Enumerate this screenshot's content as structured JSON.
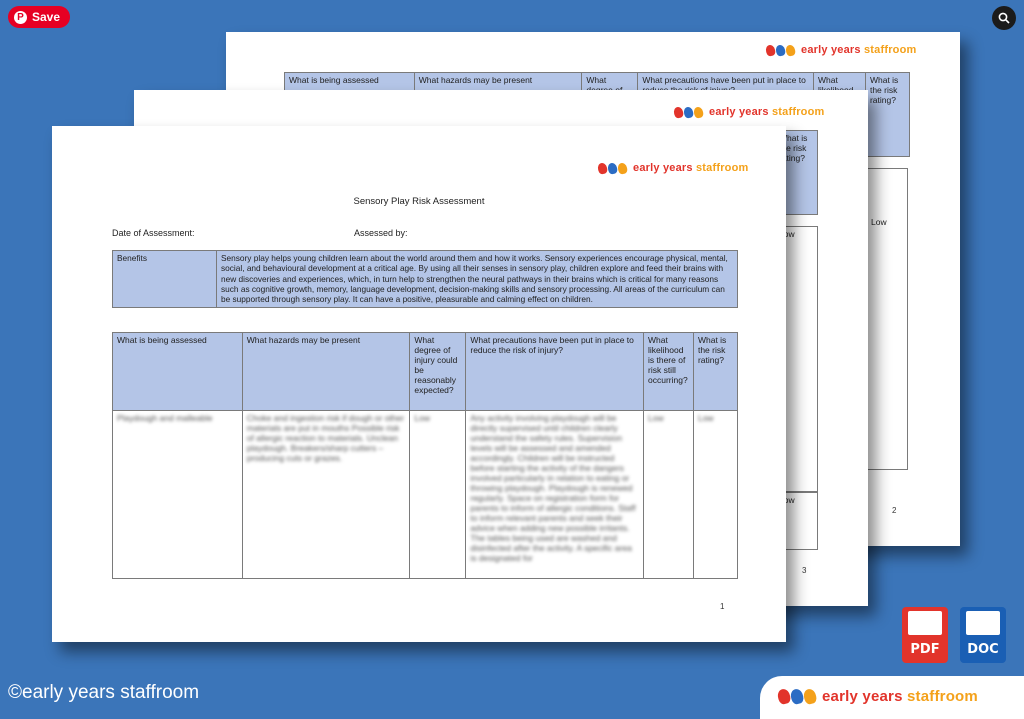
{
  "toolbar": {
    "save_label": "Save",
    "lens_icon": "visual-search-icon"
  },
  "brand": {
    "early": "early years",
    "staffroom": "staffroom",
    "copyright": "©early years staffroom"
  },
  "colors": {
    "background": "#3b75b9",
    "header_fill": "#b4c5e7",
    "save_red": "#e60023",
    "pdf_red": "#e2342b",
    "doc_blue": "#1a5fb4"
  },
  "page2": {
    "headers": [
      "What is being assessed",
      "What hazards may be present",
      "What degree of",
      "What precautions have been put in place to reduce the risk of injury?",
      "What likelihood",
      "What is the risk rating?"
    ],
    "low": "Low",
    "page_number": "2"
  },
  "page3": {
    "header_fragment": "What is the risk rating?",
    "low_1": "Low",
    "low_2": "Low",
    "page_number": "3"
  },
  "page1": {
    "title": "Sensory Play Risk Assessment",
    "date_label": "Date of Assessment:",
    "assessed_by_label": "Assessed by:",
    "benefits_label": "Benefits",
    "benefits_text": "Sensory play helps young children learn about the world around them and how it works. Sensory experiences encourage physical, mental, social, and behavioural development at a critical age. By using all their senses in sensory play, children explore and feed their brains with new discoveries and experiences, which, in turn help to strengthen the neural pathways in their brains which is critical for many reasons such as cognitive growth, memory, language development, decision-making skills and sensory processing. All areas of the curriculum can be supported through sensory play.  It can have a positive, pleasurable and calming effect on children.",
    "headers": [
      "What is being assessed",
      "What hazards may be present",
      "What degree of injury could be reasonably expected?",
      "What precautions have been put in place to reduce the risk of injury?",
      "What likelihood is there of risk still occurring?",
      "What is the risk rating?"
    ],
    "row_blurred": {
      "assessed": "Playdough and malleable",
      "hazards": "Choke and ingestion risk if dough or other materials are put in mouths Possible risk of allergic reaction to materials. Unclean playdough. Breakers/sharp cutters – producing cuts or grazes.",
      "degree": "Low",
      "precautions": "Any activity involving playdough will be directly supervised until children clearly understand the safety rules. Supervision levels will be assessed and amended accordingly. Children will be instructed before starting the activity of the dangers involved particularly in relation to eating or throwing playdough. Playdough is renewed regularly. Space on registration form for parents to inform of allergic conditions. Staff to inform relevant parents and seek their advice when adding new possible irritants. The tables being used are washed and disinfected after the activity. A specific area is designated for",
      "likelihood": "Low",
      "rating": "Low"
    },
    "page_number": "1"
  },
  "badges": {
    "pdf": "PDF",
    "doc": "DOC"
  }
}
